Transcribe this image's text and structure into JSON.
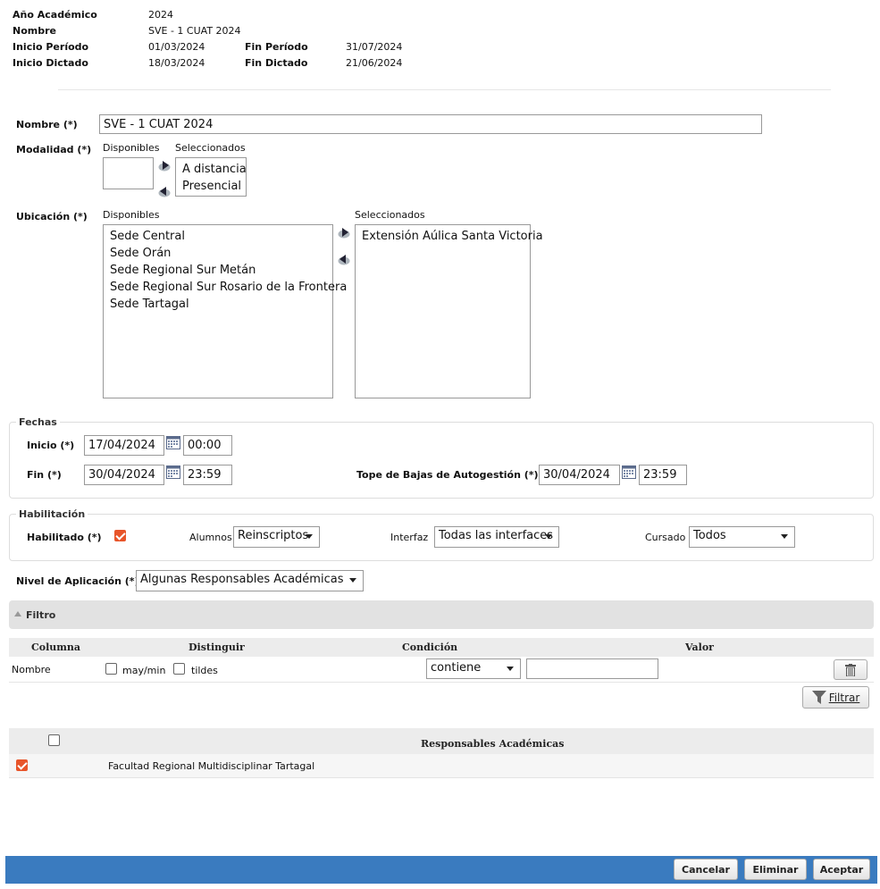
{
  "header": {
    "anio_label": "Año Académico",
    "anio_value": "2024",
    "nombre_label": "Nombre",
    "nombre_value": "SVE - 1 CUAT 2024",
    "inicio_periodo_label": "Inicio Período",
    "inicio_periodo_value": "01/03/2024",
    "fin_periodo_label": "Fin Período",
    "fin_periodo_value": "31/07/2024",
    "inicio_dictado_label": "Inicio Dictado",
    "inicio_dictado_value": "18/03/2024",
    "fin_dictado_label": "Fin Dictado",
    "fin_dictado_value": "21/06/2024"
  },
  "form": {
    "nombre_label": "Nombre (*)",
    "nombre_value": "SVE - 1 CUAT 2024",
    "modalidad_label": "Modalidad (*)",
    "disponibles_label": "Disponibles",
    "seleccionados_label": "Seleccionados",
    "modalidad_disponibles": [],
    "modalidad_seleccionados": [
      "A distancia",
      "Presencial"
    ],
    "ubicacion_label": "Ubicación (*)",
    "ubicacion_disponibles": [
      "Sede Central",
      "Sede Orán",
      "Sede Regional Sur Metán",
      "Sede Regional Sur Rosario de la Frontera",
      "Sede Tartagal"
    ],
    "ubicacion_seleccionados": [
      "Extensión Aúlica Santa Victoria"
    ]
  },
  "fechas": {
    "legend": "Fechas",
    "inicio_label": "Inicio (*)",
    "inicio_date": "17/04/2024",
    "inicio_time": "00:00",
    "fin_label": "Fin (*)",
    "fin_date": "30/04/2024",
    "fin_time": "23:59",
    "tope_label": "Tope de Bajas de Autogestión (*)",
    "tope_date": "30/04/2024",
    "tope_time": "23:59"
  },
  "habilitacion": {
    "legend": "Habilitación",
    "habilitado_label": "Habilitado (*)",
    "habilitado_checked": true,
    "alumnos_label": "Alumnos",
    "alumnos_value": "Reinscriptos",
    "interfaz_label": "Interfaz",
    "interfaz_value": "Todas las interfaces",
    "cursado_label": "Cursado",
    "cursado_value": "Todos"
  },
  "nivel": {
    "label": "Nivel de Aplicación (*)",
    "value": "Algunas Responsables Académicas"
  },
  "filtro": {
    "title": "Filtro",
    "col_columna": "Columna",
    "col_distinguir": "Distinguir",
    "col_condicion": "Condición",
    "col_valor": "Valor",
    "row_columna": "Nombre",
    "maymin_label": "may/min",
    "tildes_label": "tildes",
    "condicion_value": "contiene",
    "valor_value": "",
    "filtrar_label": "Filtrar"
  },
  "responsables": {
    "header": "Responsables Académicas",
    "rows": [
      {
        "checked": true,
        "name": "Facultad Regional Multidisciplinar Tartagal"
      }
    ]
  },
  "footer": {
    "cancelar": "Cancelar",
    "eliminar": "Eliminar",
    "aceptar": "Aceptar"
  },
  "colors": {
    "accent": "#e8552a",
    "footer_bar": "#3a7bbf"
  }
}
